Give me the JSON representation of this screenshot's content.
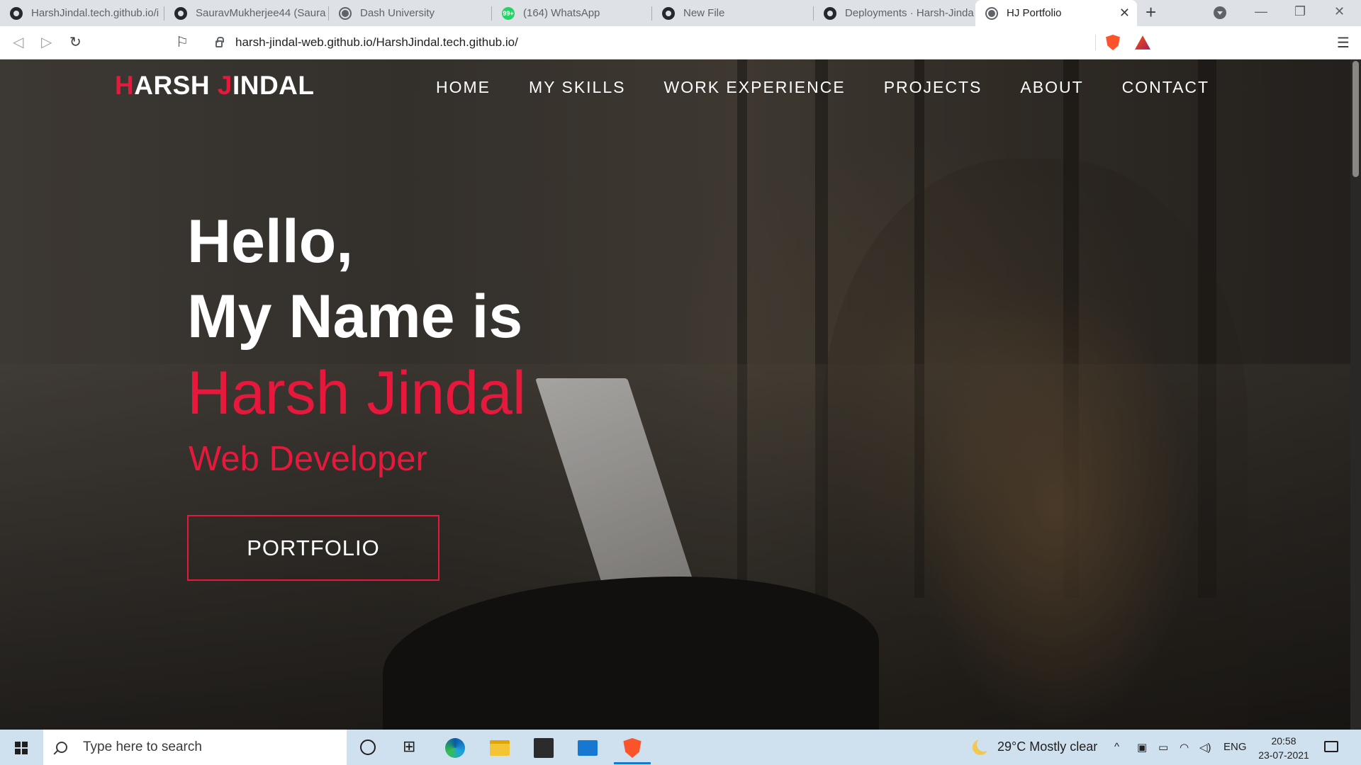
{
  "browser": {
    "tabs": [
      {
        "title": "HarshJindal.tech.github.io/i",
        "favicon": "github-icon"
      },
      {
        "title": "SauravMukherjee44 (Saura",
        "favicon": "github-icon"
      },
      {
        "title": "Dash University",
        "favicon": "globe-icon"
      },
      {
        "title": "(164) WhatsApp",
        "favicon": "whatsapp-icon",
        "badge": "99+"
      },
      {
        "title": "New File",
        "favicon": "github-icon"
      },
      {
        "title": "Deployments · Harsh-Jinda",
        "favicon": "github-icon"
      },
      {
        "title": "HJ Portfolio",
        "favicon": "globe-icon",
        "active": true
      }
    ],
    "address": "harsh-jindal-web.github.io/HarshJindal.tech.github.io/",
    "new_tab_symbol": "+",
    "close_symbol": "✕",
    "window_controls": {
      "minimize": "—",
      "restore": "❐",
      "close": "✕"
    },
    "nav": {
      "back": "◁",
      "forward": "▷",
      "reload": "↻",
      "bookmark": "⚐",
      "menu": "☰"
    }
  },
  "site": {
    "logo_first_initial": "H",
    "logo_first_rest": "ARSH ",
    "logo_last_initial": "J",
    "logo_last_rest": "INDAL",
    "nav": [
      "HOME",
      "MY SKILLS",
      "WORK EXPERIENCE",
      "PROJECTS",
      "ABOUT",
      "CONTACT"
    ],
    "hero": {
      "line1": "Hello,",
      "line2": "My Name is",
      "name": "Harsh Jindal",
      "role": "Web Developer",
      "cta": "PORTFOLIO"
    },
    "accent_color": "#e6193c"
  },
  "taskbar": {
    "search_placeholder": "Type here to search",
    "weather": "29°C  Mostly clear",
    "language": "ENG",
    "time": "20:58",
    "date": "23-07-2021",
    "tray_chevron": "^"
  }
}
